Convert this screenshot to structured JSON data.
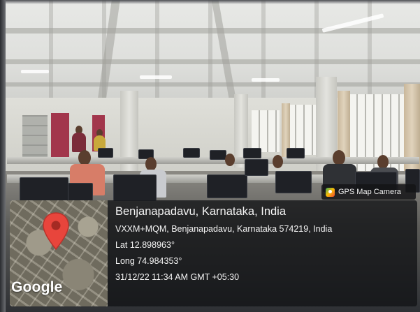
{
  "gps_badge": {
    "label": "GPS Map Camera",
    "icon": "gps-map-camera-icon"
  },
  "location": {
    "title": "Benjanapadavu, Karnataka, India",
    "address": "VXXM+MQM, Benjanapadavu, Karnataka 574219, India",
    "lat": "Lat 12.898963°",
    "long": "Long 74.984353°",
    "datetime": "31/12/22 11:34 AM GMT +05:30"
  },
  "map": {
    "brand": "Google",
    "pin_icon": "map-pin-icon",
    "pin_color": "#e8453c"
  }
}
